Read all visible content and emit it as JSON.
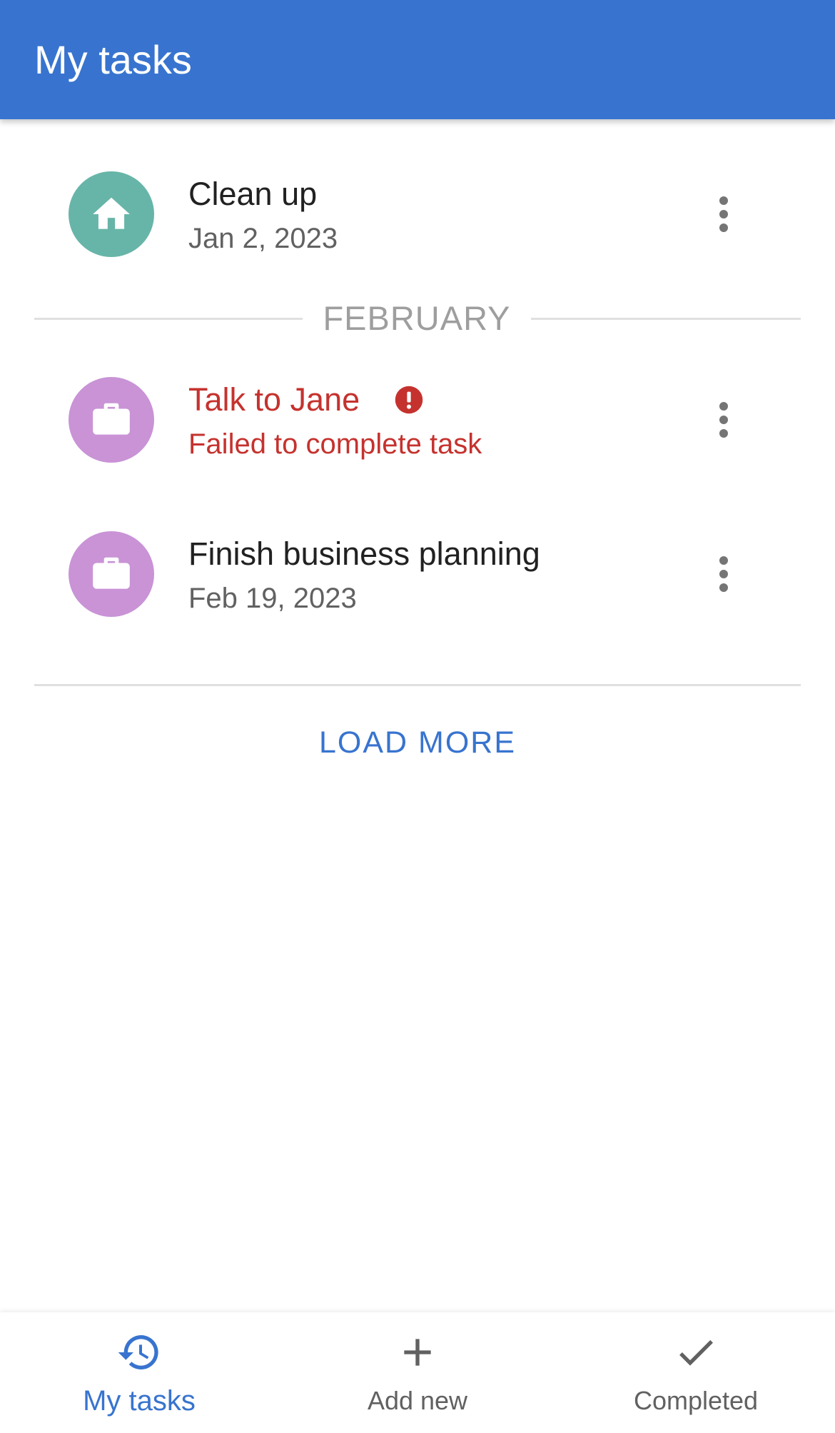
{
  "app_bar": {
    "title": "My tasks",
    "color": "#3874cf"
  },
  "tasks": [
    {
      "name": "Clean up",
      "subtitle": "Jan 2, 2023",
      "icon": "home-icon",
      "avatar_color": "#67b5a8",
      "status": "normal"
    },
    {
      "name": "Talk to Jane",
      "subtitle": "Failed to complete task",
      "icon": "briefcase-icon",
      "avatar_color": "#c993d6",
      "status": "error",
      "status_icon": "error-icon",
      "error_color": "#c5322e"
    },
    {
      "name": "Finish business planning",
      "subtitle": "Feb 19, 2023",
      "icon": "briefcase-icon",
      "avatar_color": "#c993d6",
      "status": "normal"
    }
  ],
  "section": {
    "label": "FEBRUARY"
  },
  "load_more": {
    "label": "LOAD MORE"
  },
  "bottom_nav": {
    "items": [
      {
        "label": "My tasks",
        "icon": "history-icon",
        "active": true
      },
      {
        "label": "Add new",
        "icon": "plus-icon",
        "active": false
      },
      {
        "label": "Completed",
        "icon": "check-icon",
        "active": false
      }
    ]
  }
}
